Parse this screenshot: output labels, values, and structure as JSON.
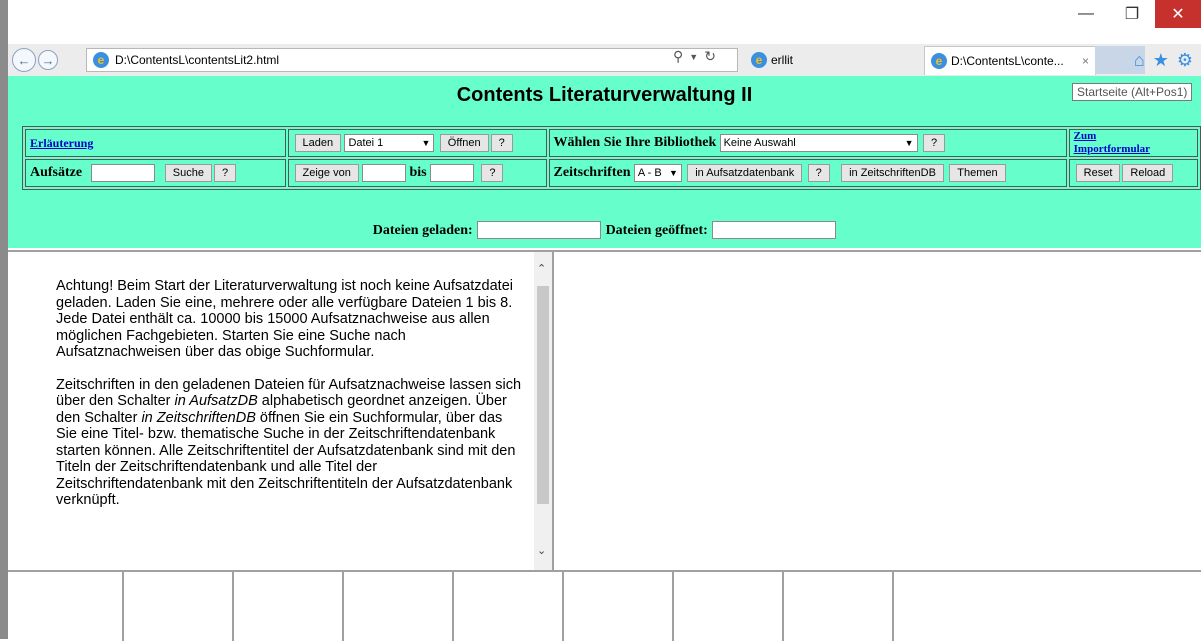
{
  "browser": {
    "address": "D:\\ContentsL\\contentsLit2.html",
    "tab_inactive": "erllit",
    "tab_active": "D:\\ContentsL\\conte...",
    "tooltip": "Startseite (Alt+Pos1)"
  },
  "header": {
    "title": "Contents Literaturverwaltung II"
  },
  "row1": {
    "explain_link": "Erläuterung",
    "load_button": "Laden",
    "file_select": "Datei 1",
    "open_button": "Öffnen",
    "help": "?",
    "library_label": "Wählen Sie Ihre Bibliothek",
    "library_select": "Keine Auswahl",
    "import_link_1": "Zum",
    "import_link_2": "Importformular"
  },
  "row2": {
    "articles_label": "Aufsätze",
    "search_button": "Suche",
    "show_from_button": "Zeige von",
    "to_label": "bis",
    "journals_label": "Zeitschriften",
    "range_select": "A - B",
    "in_article_db_button": "in Aufsatzdatenbank",
    "in_journal_db_button": "in ZeitschriftenDB",
    "topics_button": "Themen",
    "reset_button": "Reset",
    "reload_button": "Reload"
  },
  "status": {
    "loaded_label": "Dateien geladen:",
    "opened_label": "Dateien geöffnet:"
  },
  "content": {
    "p1": "Achtung! Beim Start der Literaturverwaltung ist noch keine Aufsatzdatei geladen. Laden Sie eine, mehrere oder alle verfügbare Dateien 1 bis 8. Jede Datei enthält ca. 10000 bis 15000  Aufsatznachweise aus allen möglichen Fachgebieten. Starten Sie eine Suche nach Aufsatznachweisen über das obige Suchformular.",
    "p2a": "Zeitschriften in den geladenen Dateien für Aufsatznachweise lassen sich über den Schalter ",
    "p2b": "in AufsatzDB",
    "p2c": "  alphabetisch geordnet anzeigen. Über den  Schalter ",
    "p2d": "in ZeitschriftenDB",
    "p2e": " öffnen Sie ein Suchformular, über das Sie eine Titel- bzw. thematische Suche in der Zeitschriftendatenbank starten können. Alle Zeitschriftentitel der Aufsatzdatenbank sind mit den Titeln der Zeitschriftendatenbank und alle Titel der Zeitschriftendatenbank mit den Zeitschriftentiteln der Aufsatzdatenbank verknüpft."
  },
  "colors": {
    "frame_bg": "#66ffcc",
    "close": "#c6302d"
  }
}
